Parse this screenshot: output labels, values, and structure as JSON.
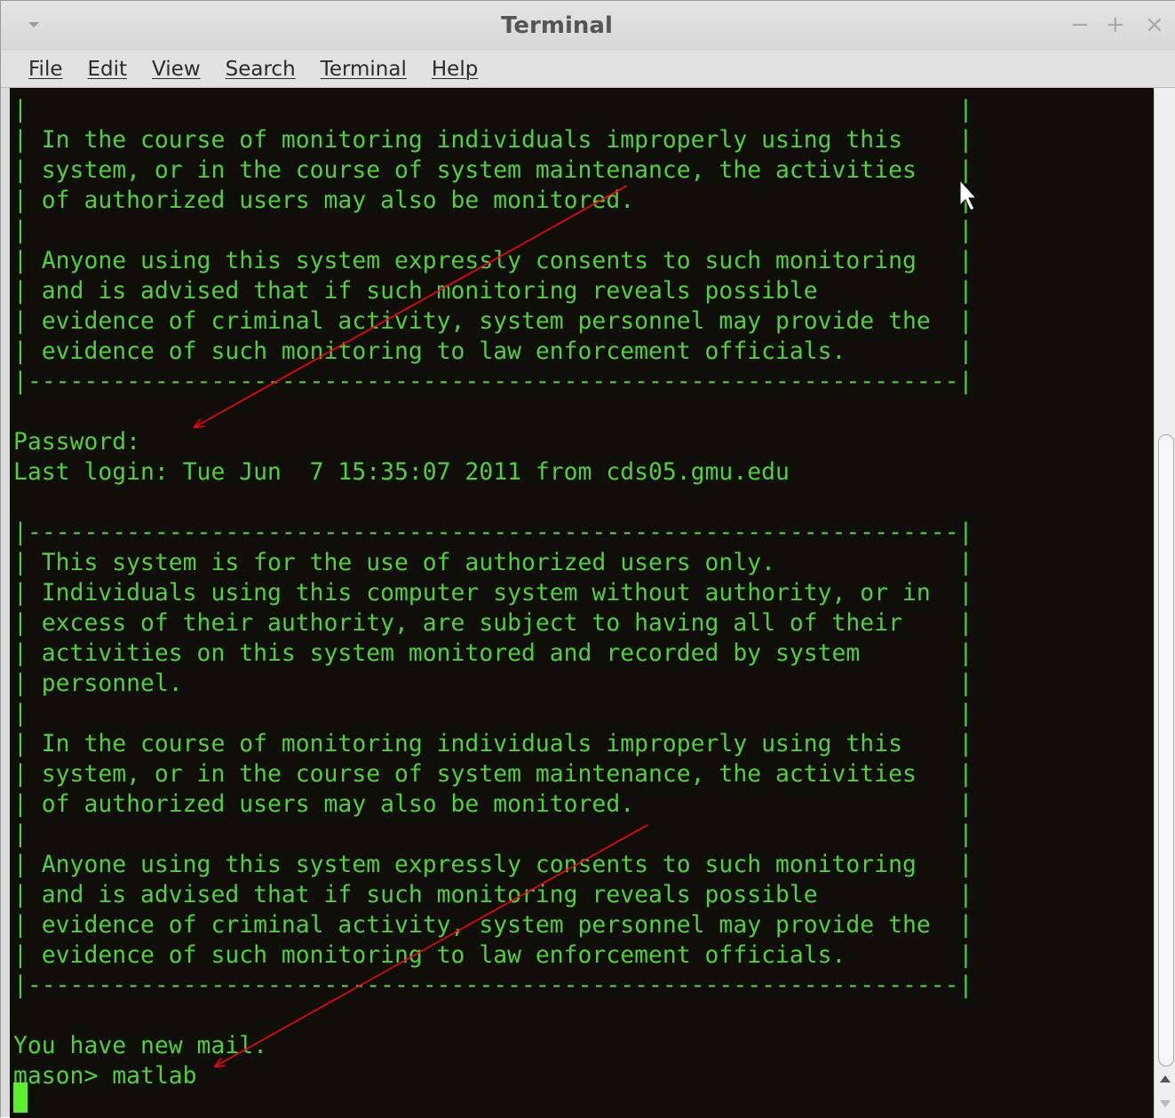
{
  "window": {
    "title": "Terminal",
    "controls": {
      "minimize": "−",
      "maximize": "+",
      "close": "×"
    }
  },
  "menubar": {
    "items": [
      {
        "label": "File"
      },
      {
        "label": "Edit"
      },
      {
        "label": "View"
      },
      {
        "label": "Search"
      },
      {
        "label": "Terminal"
      },
      {
        "label": "Help"
      }
    ]
  },
  "terminal": {
    "colors": {
      "background": "#0f0e08",
      "text": "#52d03a",
      "cursor": "#5cef2d",
      "annotation_arrow": "#ff0000"
    },
    "lines": [
      "|                                                                  |",
      "| In the course of monitoring individuals improperly using this    |",
      "| system, or in the course of system maintenance, the activities   |",
      "| of authorized users may also be monitored.                       |",
      "|                                                                  |",
      "| Anyone using this system expressly consents to such monitoring   |",
      "| and is advised that if such monitoring reveals possible          |",
      "| evidence of criminal activity, system personnel may provide the  |",
      "| evidence of such monitoring to law enforcement officials.        |",
      "|------------------------------------------------------------------|",
      "",
      "Password:",
      "Last login: Tue Jun  7 15:35:07 2011 from cds05.gmu.edu",
      "",
      "|------------------------------------------------------------------|",
      "| This system is for the use of authorized users only.             |",
      "| Individuals using this computer system without authority, or in  |",
      "| excess of their authority, are subject to having all of their    |",
      "| activities on this system monitored and recorded by system       |",
      "| personnel.                                                       |",
      "|                                                                  |",
      "| In the course of monitoring individuals improperly using this    |",
      "| system, or in the course of system maintenance, the activities   |",
      "| of authorized users may also be monitored.                       |",
      "|                                                                  |",
      "| Anyone using this system expressly consents to such monitoring   |",
      "| and is advised that if such monitoring reveals possible          |",
      "| evidence of criminal activity, system personnel may provide the  |",
      "| evidence of such monitoring to law enforcement officials.        |",
      "|------------------------------------------------------------------|",
      "",
      "You have new mail.",
      "mason> matlab"
    ]
  }
}
